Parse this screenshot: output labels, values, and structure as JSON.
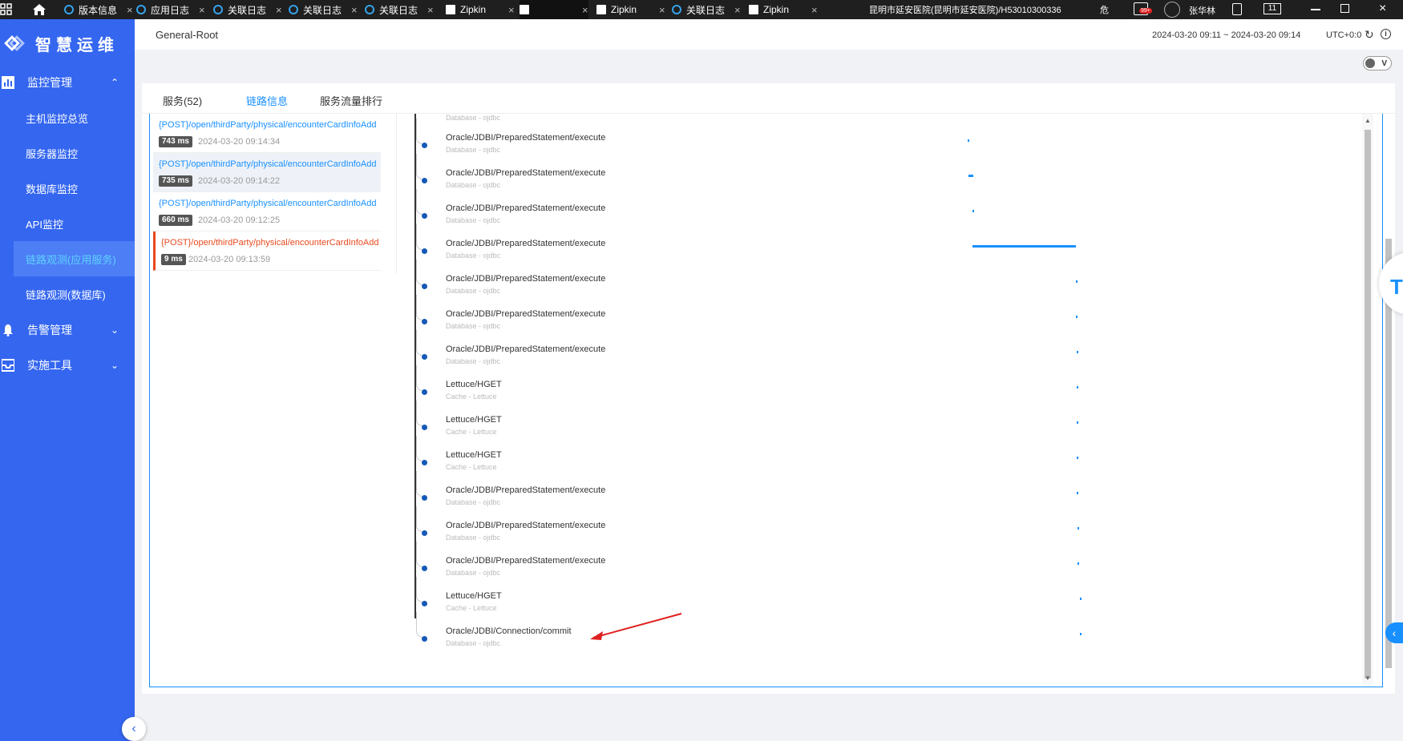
{
  "browser": {
    "tabs": [
      {
        "label": "版本信息",
        "icon": "wh"
      },
      {
        "label": "应用日志",
        "icon": "wh"
      },
      {
        "label": "关联日志",
        "icon": "wh"
      },
      {
        "label": "关联日志",
        "icon": "wh"
      },
      {
        "label": "关联日志",
        "icon": "wh"
      },
      {
        "label": "Zipkin",
        "icon": "doc"
      },
      {
        "label": "",
        "icon": "doc"
      },
      {
        "label": "Zipkin",
        "icon": "doc"
      },
      {
        "label": "关联日志",
        "icon": "wh"
      },
      {
        "label": "Zipkin",
        "icon": "doc"
      }
    ],
    "close_glyph": "×",
    "hospital": "昆明市延安医院(昆明市延安医院)/H53010300336",
    "danger": "危",
    "notify_count": "99+",
    "user": "张华林",
    "badge": "11"
  },
  "sidebar": {
    "title": "智慧运维",
    "menus": [
      {
        "label": "监控管理",
        "chevron": "⌃"
      },
      {
        "label": "告警管理",
        "chevron": "⌄"
      },
      {
        "label": "实施工具",
        "chevron": "⌄"
      }
    ],
    "sub_items": [
      {
        "label": "主机监控总览"
      },
      {
        "label": "服务器监控"
      },
      {
        "label": "数据库监控"
      },
      {
        "label": "API监控"
      },
      {
        "label": "链路观测(应用服务)"
      },
      {
        "label": "链路观测(数据库)"
      }
    ],
    "collapse_glyph": "‹"
  },
  "header": {
    "breadcrumb": "General-Root",
    "time_range": "2024-03-20 09:11 ~ 2024-03-20 09:14",
    "timezone": "UTC+0:0",
    "refresh_glyph": "↻",
    "info_glyph": "i",
    "toggle_label": "V"
  },
  "tabs": [
    {
      "label": "服务(52)"
    },
    {
      "label": "链路信息"
    },
    {
      "label": "服务流量排行"
    }
  ],
  "traces": [
    {
      "url": "{POST}/open/thirdParty/physical/encounterCardInfoAdd",
      "duration": "743 ms",
      "time": "2024-03-20 09:14:34",
      "status": "normal"
    },
    {
      "url": "{POST}/open/thirdParty/physical/encounterCardInfoAdd",
      "duration": "735 ms",
      "time": "2024-03-20 09:14:22",
      "status": "selected"
    },
    {
      "url": "{POST}/open/thirdParty/physical/encounterCardInfoAdd",
      "duration": "660 ms",
      "time": "2024-03-20 09:12:25",
      "status": "normal"
    },
    {
      "url": "{POST}/open/thirdParty/physical/encounterCardInfoAdd",
      "duration": "9 ms",
      "time": "2024-03-20 09:13:59",
      "status": "error"
    }
  ],
  "spans_partial_sub": "Database - ojdbc",
  "spans": [
    {
      "name": "Oracle/JDBI/PreparedStatement/execute",
      "sub": "Database - ojdbc",
      "bar": 0.59,
      "bar_w": 0.002
    },
    {
      "name": "Oracle/JDBI/PreparedStatement/execute",
      "sub": "Database - ojdbc",
      "bar": 0.591,
      "bar_w": 0.005
    },
    {
      "name": "Oracle/JDBI/PreparedStatement/execute",
      "sub": "Database - ojdbc",
      "bar": 0.595,
      "bar_w": 0.002
    },
    {
      "name": "Oracle/JDBI/PreparedStatement/execute",
      "sub": "Database - ojdbc",
      "bar": 0.595,
      "bar_w": 0.11
    },
    {
      "name": "Oracle/JDBI/PreparedStatement/execute",
      "sub": "Database - ojdbc",
      "bar": 0.705,
      "bar_w": 0.002
    },
    {
      "name": "Oracle/JDBI/PreparedStatement/execute",
      "sub": "Database - ojdbc",
      "bar": 0.705,
      "bar_w": 0.002
    },
    {
      "name": "Oracle/JDBI/PreparedStatement/execute",
      "sub": "Database - ojdbc",
      "bar": 0.706,
      "bar_w": 0.002
    },
    {
      "name": "Lettuce/HGET",
      "sub": "Cache - Lettuce",
      "bar": 0.706,
      "bar_w": 0.002
    },
    {
      "name": "Lettuce/HGET",
      "sub": "Cache - Lettuce",
      "bar": 0.706,
      "bar_w": 0.002
    },
    {
      "name": "Lettuce/HGET",
      "sub": "Cache - Lettuce",
      "bar": 0.706,
      "bar_w": 0.002
    },
    {
      "name": "Oracle/JDBI/PreparedStatement/execute",
      "sub": "Database - ojdbc",
      "bar": 0.706,
      "bar_w": 0.002
    },
    {
      "name": "Oracle/JDBI/PreparedStatement/execute",
      "sub": "Database - ojdbc",
      "bar": 0.707,
      "bar_w": 0.002
    },
    {
      "name": "Oracle/JDBI/PreparedStatement/execute",
      "sub": "Database - ojdbc",
      "bar": 0.707,
      "bar_w": 0.002
    },
    {
      "name": "Lettuce/HGET",
      "sub": "Cache - Lettuce",
      "bar": 0.709,
      "bar_w": 0.002
    },
    {
      "name": "Oracle/JDBI/Connection/commit",
      "sub": "Database - ojdbc",
      "bar": 0.709,
      "bar_w": 0.002
    }
  ],
  "colors": {
    "sidebar": "#3466f0",
    "accent": "#1890ff",
    "error": "#e8491d",
    "annotation": "#e02020"
  }
}
